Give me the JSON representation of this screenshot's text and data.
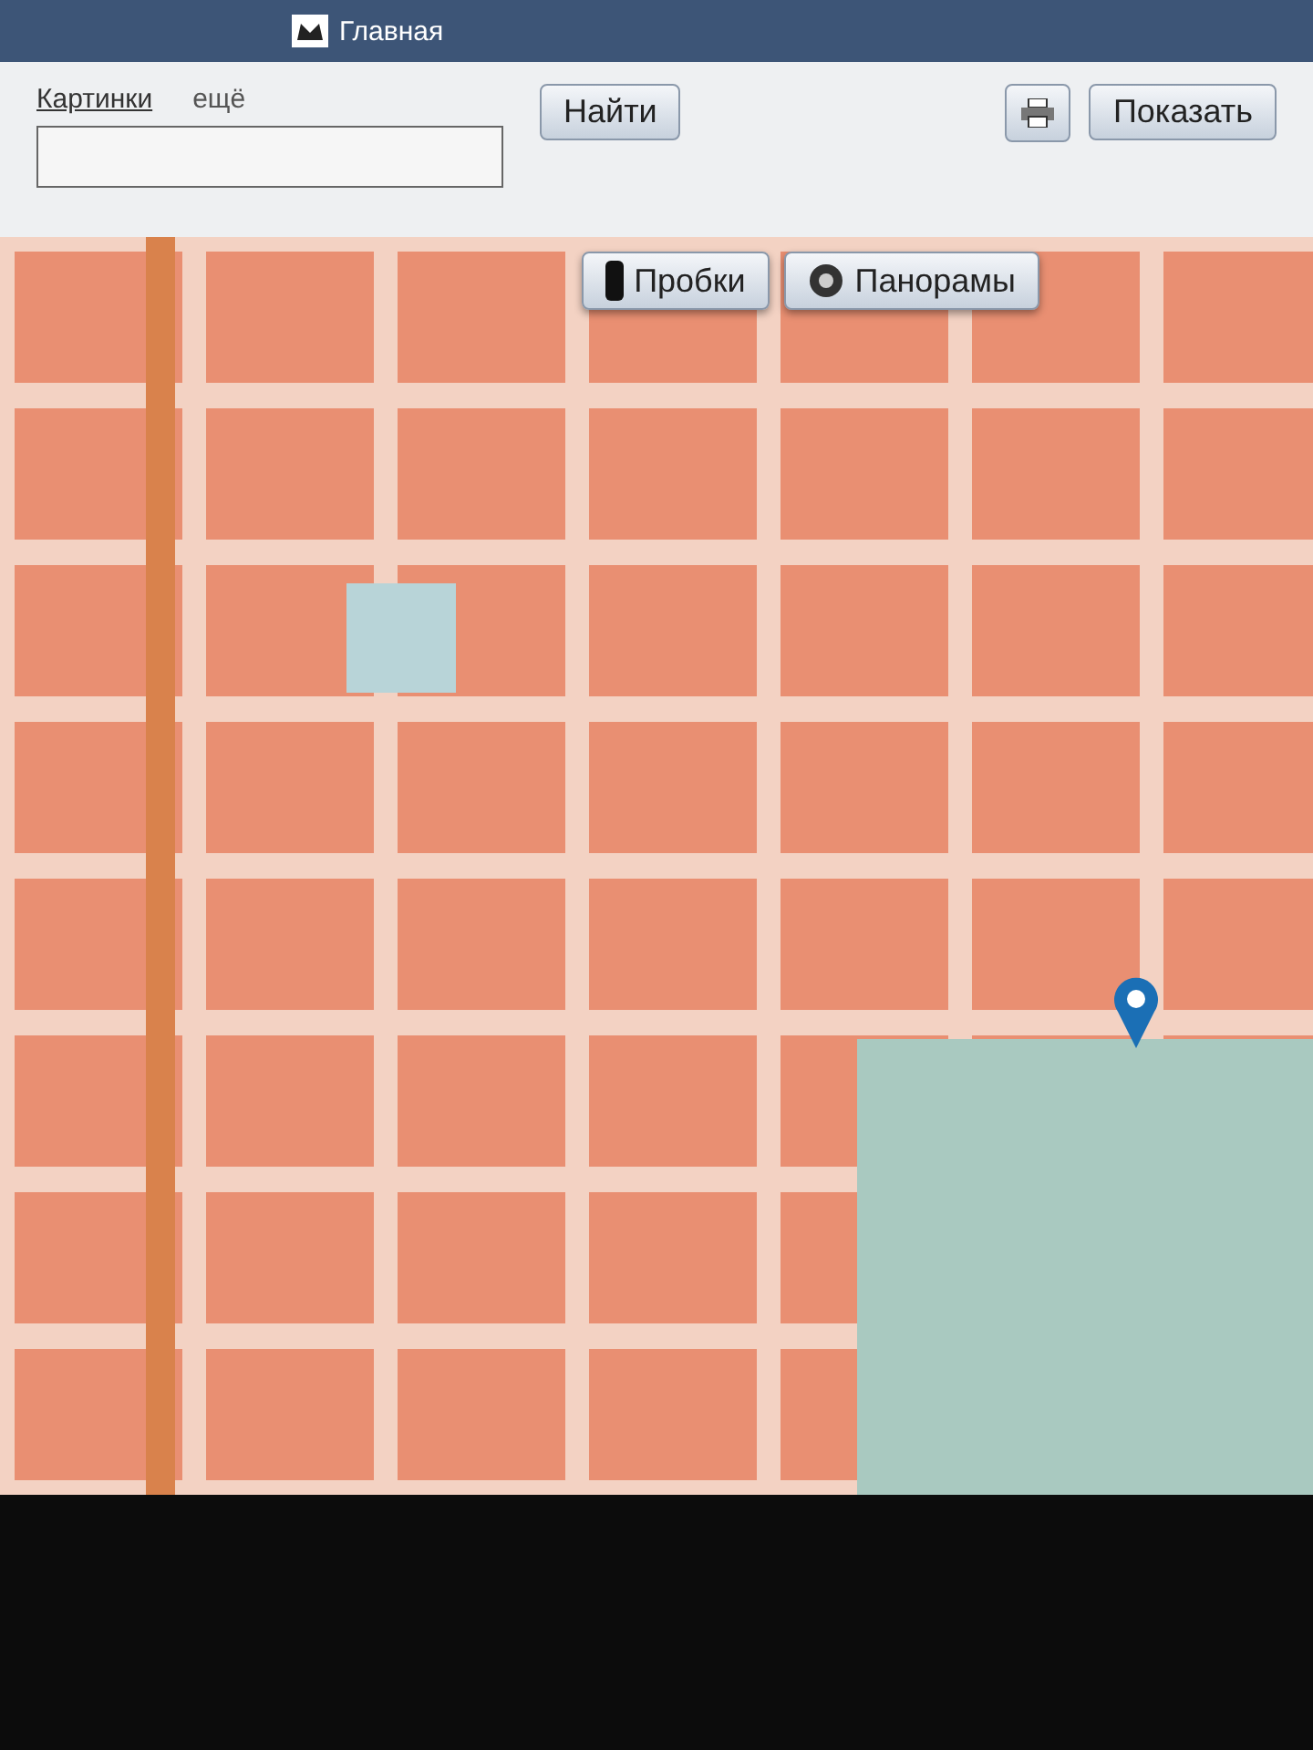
{
  "header": {
    "tab": "Главная"
  },
  "search": {
    "links": [
      "Картинки",
      "ещё"
    ],
    "button": "Найти"
  },
  "toolbar": {
    "show_button": "Показать"
  },
  "map": {
    "layers": [
      {
        "label": "Пробки",
        "kind": "traffic"
      },
      {
        "label": "Панорамы",
        "kind": "panorama"
      }
    ]
  }
}
